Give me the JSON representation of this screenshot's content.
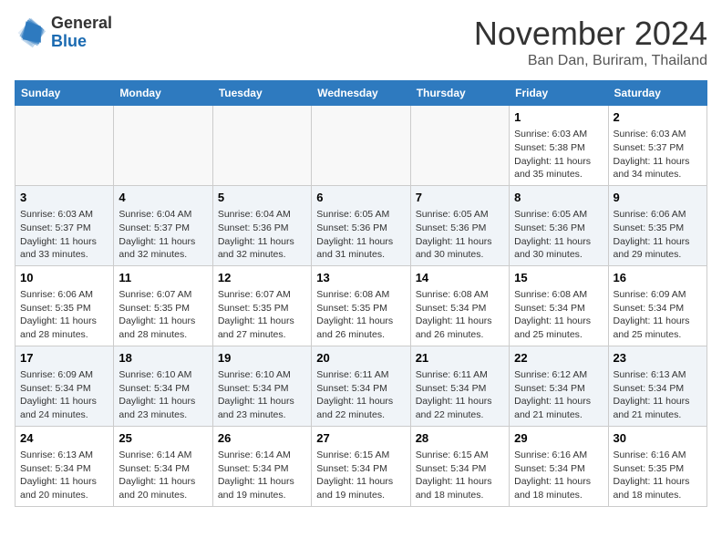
{
  "header": {
    "logo_line1": "General",
    "logo_line2": "Blue",
    "month": "November 2024",
    "location": "Ban Dan, Buriram, Thailand"
  },
  "weekdays": [
    "Sunday",
    "Monday",
    "Tuesday",
    "Wednesday",
    "Thursday",
    "Friday",
    "Saturday"
  ],
  "weeks": [
    [
      {
        "day": "",
        "info": ""
      },
      {
        "day": "",
        "info": ""
      },
      {
        "day": "",
        "info": ""
      },
      {
        "day": "",
        "info": ""
      },
      {
        "day": "",
        "info": ""
      },
      {
        "day": "1",
        "info": "Sunrise: 6:03 AM\nSunset: 5:38 PM\nDaylight: 11 hours and 35 minutes."
      },
      {
        "day": "2",
        "info": "Sunrise: 6:03 AM\nSunset: 5:37 PM\nDaylight: 11 hours and 34 minutes."
      }
    ],
    [
      {
        "day": "3",
        "info": "Sunrise: 6:03 AM\nSunset: 5:37 PM\nDaylight: 11 hours and 33 minutes."
      },
      {
        "day": "4",
        "info": "Sunrise: 6:04 AM\nSunset: 5:37 PM\nDaylight: 11 hours and 32 minutes."
      },
      {
        "day": "5",
        "info": "Sunrise: 6:04 AM\nSunset: 5:36 PM\nDaylight: 11 hours and 32 minutes."
      },
      {
        "day": "6",
        "info": "Sunrise: 6:05 AM\nSunset: 5:36 PM\nDaylight: 11 hours and 31 minutes."
      },
      {
        "day": "7",
        "info": "Sunrise: 6:05 AM\nSunset: 5:36 PM\nDaylight: 11 hours and 30 minutes."
      },
      {
        "day": "8",
        "info": "Sunrise: 6:05 AM\nSunset: 5:36 PM\nDaylight: 11 hours and 30 minutes."
      },
      {
        "day": "9",
        "info": "Sunrise: 6:06 AM\nSunset: 5:35 PM\nDaylight: 11 hours and 29 minutes."
      }
    ],
    [
      {
        "day": "10",
        "info": "Sunrise: 6:06 AM\nSunset: 5:35 PM\nDaylight: 11 hours and 28 minutes."
      },
      {
        "day": "11",
        "info": "Sunrise: 6:07 AM\nSunset: 5:35 PM\nDaylight: 11 hours and 28 minutes."
      },
      {
        "day": "12",
        "info": "Sunrise: 6:07 AM\nSunset: 5:35 PM\nDaylight: 11 hours and 27 minutes."
      },
      {
        "day": "13",
        "info": "Sunrise: 6:08 AM\nSunset: 5:35 PM\nDaylight: 11 hours and 26 minutes."
      },
      {
        "day": "14",
        "info": "Sunrise: 6:08 AM\nSunset: 5:34 PM\nDaylight: 11 hours and 26 minutes."
      },
      {
        "day": "15",
        "info": "Sunrise: 6:08 AM\nSunset: 5:34 PM\nDaylight: 11 hours and 25 minutes."
      },
      {
        "day": "16",
        "info": "Sunrise: 6:09 AM\nSunset: 5:34 PM\nDaylight: 11 hours and 25 minutes."
      }
    ],
    [
      {
        "day": "17",
        "info": "Sunrise: 6:09 AM\nSunset: 5:34 PM\nDaylight: 11 hours and 24 minutes."
      },
      {
        "day": "18",
        "info": "Sunrise: 6:10 AM\nSunset: 5:34 PM\nDaylight: 11 hours and 23 minutes."
      },
      {
        "day": "19",
        "info": "Sunrise: 6:10 AM\nSunset: 5:34 PM\nDaylight: 11 hours and 23 minutes."
      },
      {
        "day": "20",
        "info": "Sunrise: 6:11 AM\nSunset: 5:34 PM\nDaylight: 11 hours and 22 minutes."
      },
      {
        "day": "21",
        "info": "Sunrise: 6:11 AM\nSunset: 5:34 PM\nDaylight: 11 hours and 22 minutes."
      },
      {
        "day": "22",
        "info": "Sunrise: 6:12 AM\nSunset: 5:34 PM\nDaylight: 11 hours and 21 minutes."
      },
      {
        "day": "23",
        "info": "Sunrise: 6:13 AM\nSunset: 5:34 PM\nDaylight: 11 hours and 21 minutes."
      }
    ],
    [
      {
        "day": "24",
        "info": "Sunrise: 6:13 AM\nSunset: 5:34 PM\nDaylight: 11 hours and 20 minutes."
      },
      {
        "day": "25",
        "info": "Sunrise: 6:14 AM\nSunset: 5:34 PM\nDaylight: 11 hours and 20 minutes."
      },
      {
        "day": "26",
        "info": "Sunrise: 6:14 AM\nSunset: 5:34 PM\nDaylight: 11 hours and 19 minutes."
      },
      {
        "day": "27",
        "info": "Sunrise: 6:15 AM\nSunset: 5:34 PM\nDaylight: 11 hours and 19 minutes."
      },
      {
        "day": "28",
        "info": "Sunrise: 6:15 AM\nSunset: 5:34 PM\nDaylight: 11 hours and 18 minutes."
      },
      {
        "day": "29",
        "info": "Sunrise: 6:16 AM\nSunset: 5:34 PM\nDaylight: 11 hours and 18 minutes."
      },
      {
        "day": "30",
        "info": "Sunrise: 6:16 AM\nSunset: 5:35 PM\nDaylight: 11 hours and 18 minutes."
      }
    ]
  ]
}
